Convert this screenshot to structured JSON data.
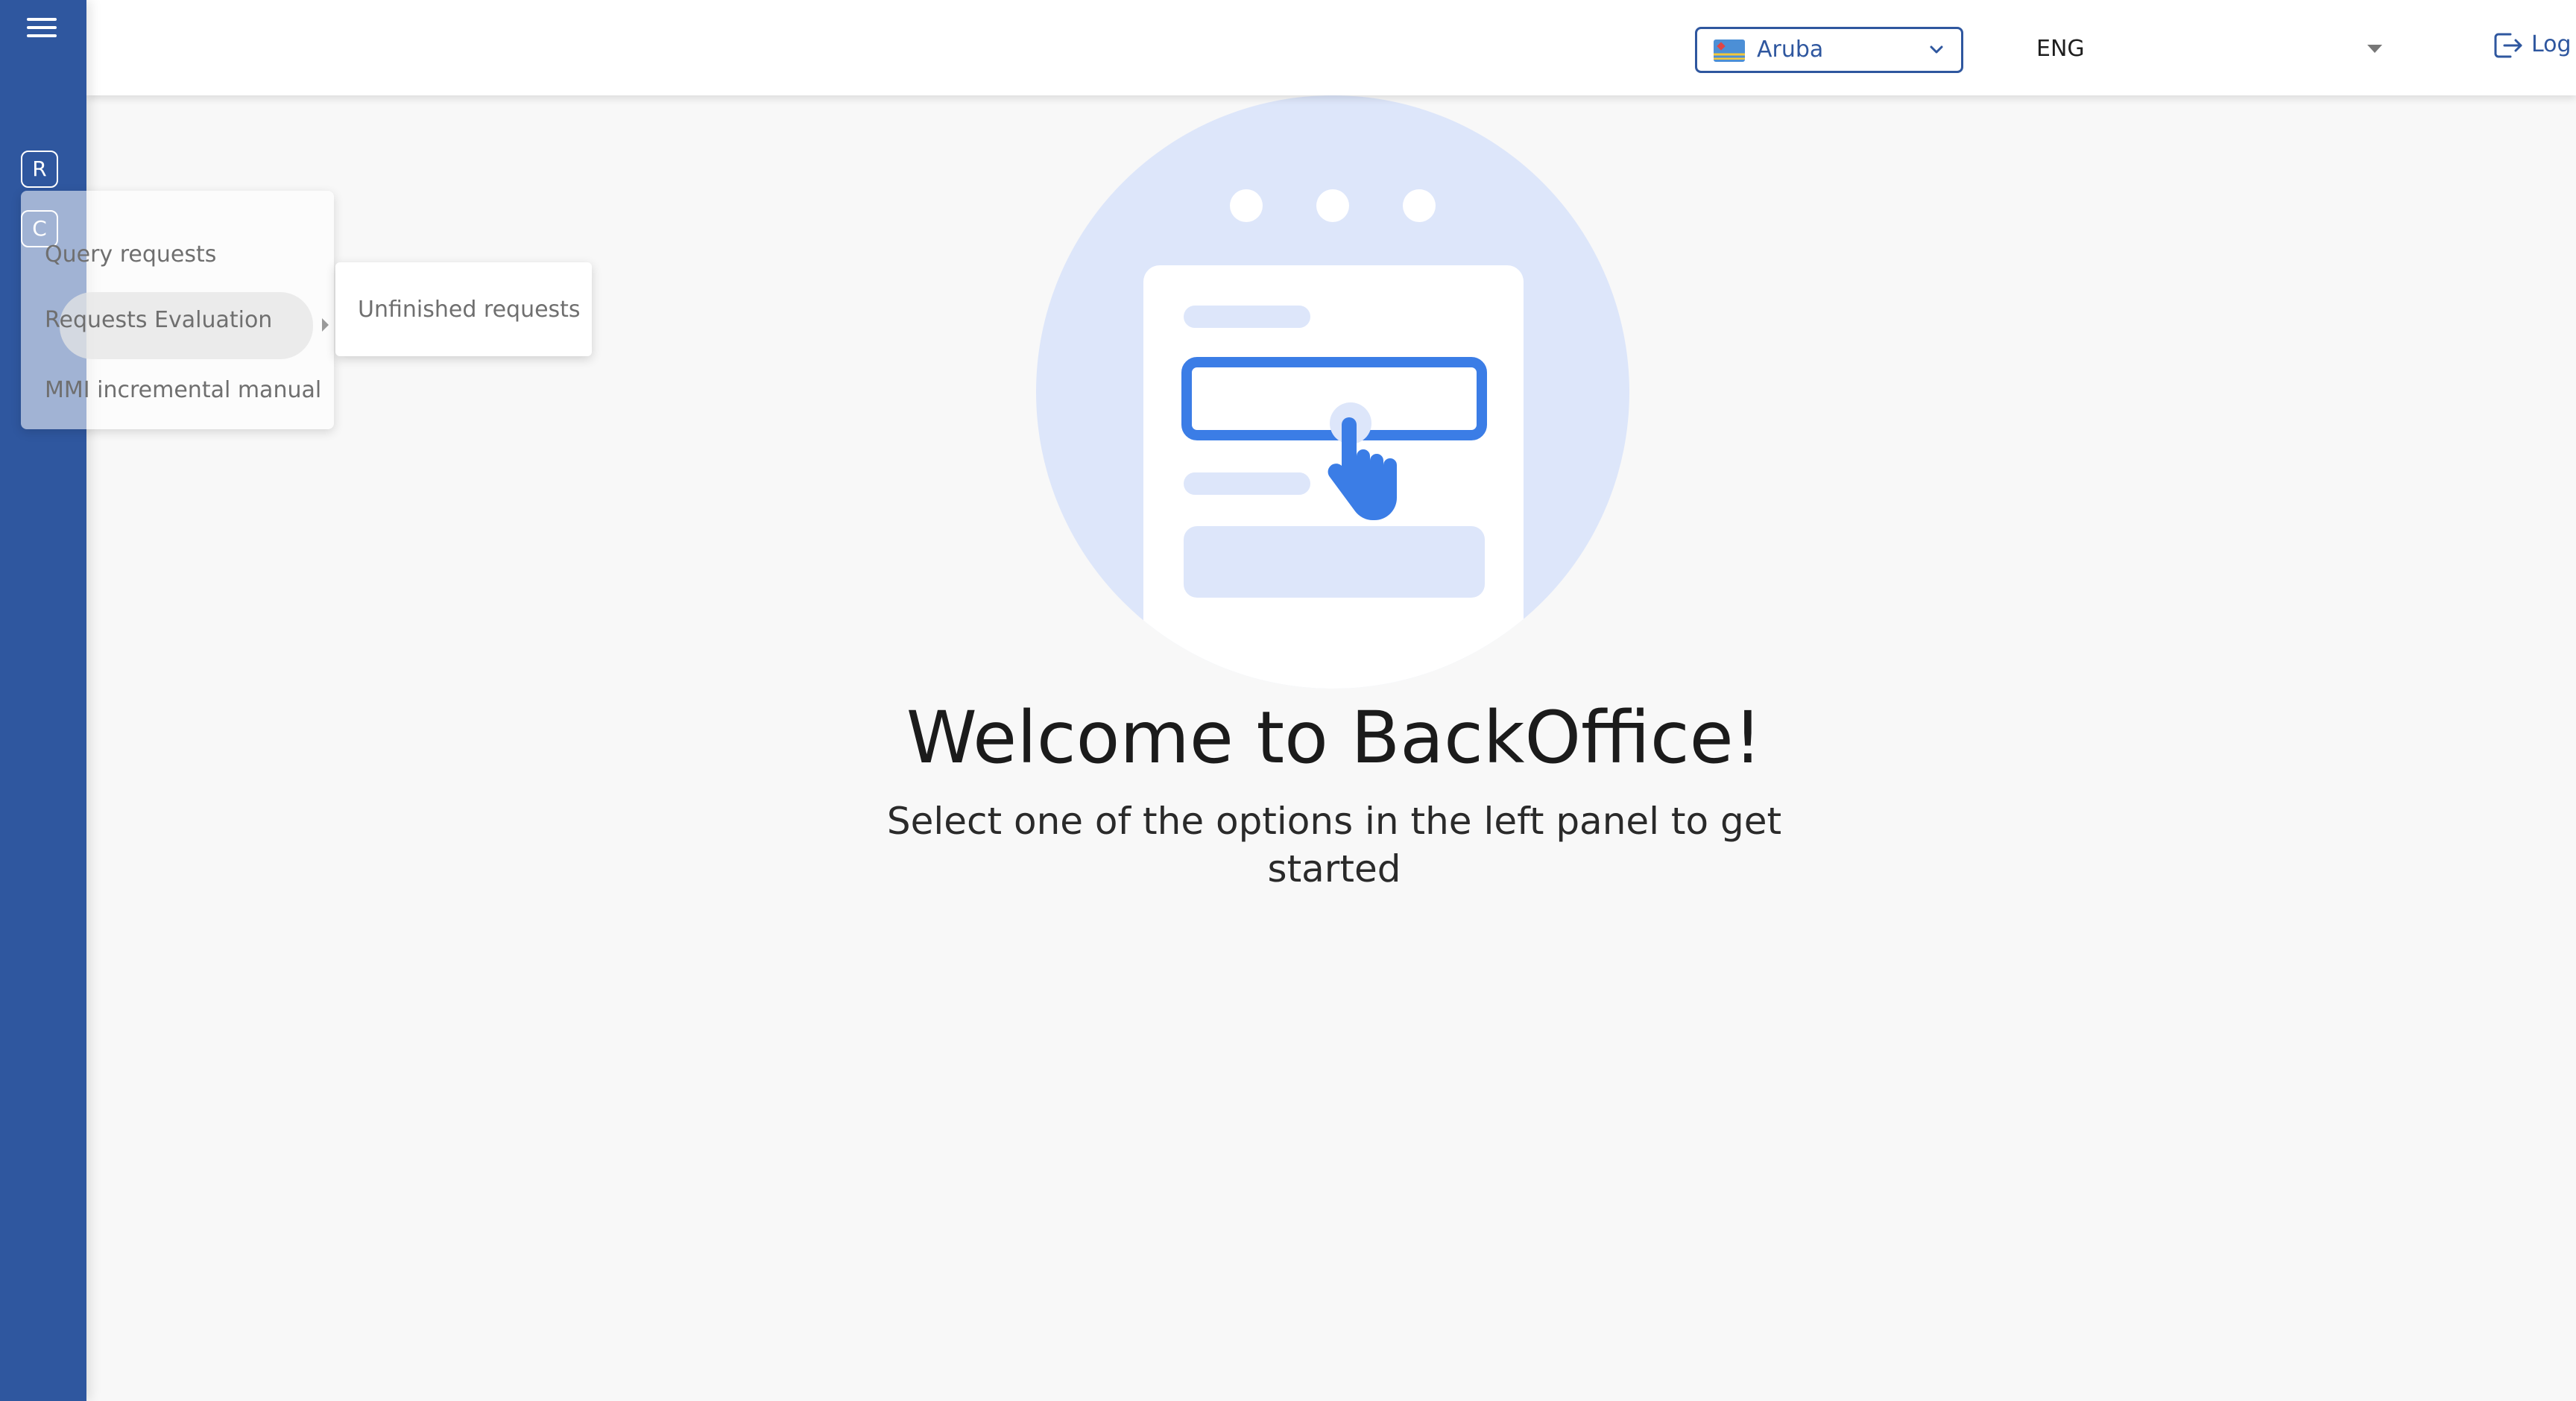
{
  "sidebar": {
    "menu_icon": "hamburger-menu-icon",
    "rail_items": [
      "R",
      "C"
    ]
  },
  "header": {
    "country_select": {
      "value": "Aruba",
      "flag_icon": "aruba-flag-icon",
      "chevron_icon": "chevron-down-icon"
    },
    "language_select": {
      "value": "ENG",
      "caret_icon": "caret-down-icon"
    },
    "logout": {
      "label": "Log out",
      "icon": "logout-icon"
    }
  },
  "main": {
    "illustration_icon": "form-click-illustration",
    "welcome_title": "Welcome to BackOffice!",
    "subtitle": "Select one of the options in the left panel to get started"
  },
  "flyout_menu": {
    "items": [
      {
        "label": "Query requests"
      },
      {
        "label": "Requests Evaluation",
        "has_submenu": true,
        "active": true
      },
      {
        "label": "MMI incremental manual"
      }
    ],
    "submenu": {
      "items": [
        {
          "label": "Unfinished requests"
        }
      ]
    }
  },
  "colors": {
    "sidebar": "#2f579f",
    "accent": "#2f579f",
    "illustration_circle": "#dde6fa",
    "illustration_blue": "#3b7de6"
  }
}
